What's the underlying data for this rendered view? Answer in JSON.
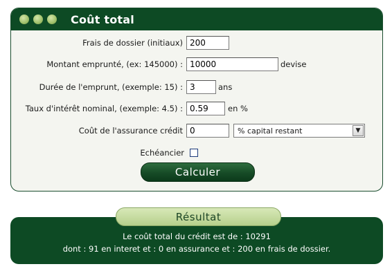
{
  "panel": {
    "title": "Coût total"
  },
  "form": {
    "frais": {
      "label": "Frais de dossier (initiaux)",
      "value": "200"
    },
    "montant": {
      "label": "Montant emprunté, (ex: 145000) :",
      "value": "10000",
      "unit": "devise"
    },
    "duree": {
      "label": "Durée de l'emprunt, (exemple: 15) :",
      "value": "3",
      "unit": "ans"
    },
    "taux": {
      "label": "Taux d'intérêt nominal, (exemple: 4.5) :",
      "value": "0.59",
      "unit": "en %"
    },
    "assurance": {
      "label": "Coût de l'assurance crédit",
      "value": "0",
      "select_value": "% capital restant"
    },
    "echeancier": {
      "label": "Echéancier",
      "checked": false
    },
    "calculer_label": "Calculer"
  },
  "result": {
    "tab_label": "Résultat",
    "line1": "Le coût total du crédit est de : 10291",
    "line2": "dont : 91 en interet et : 0 en assurance et : 200 en frais de dossier."
  },
  "colors": {
    "dark_green": "#0d4a24",
    "light_green": "#b6d08c",
    "panel_bg": "#f4f5f0"
  }
}
